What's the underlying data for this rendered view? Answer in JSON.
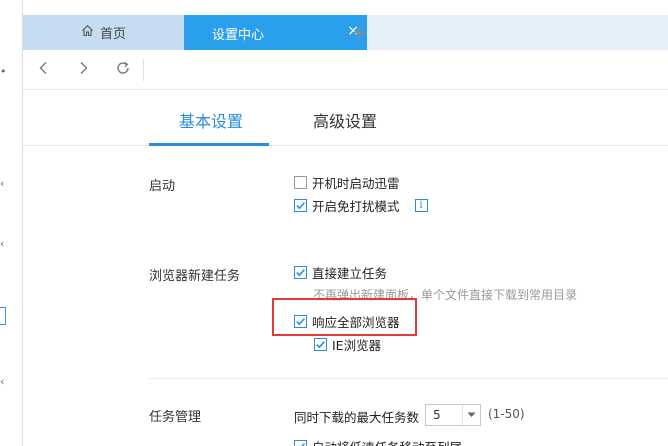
{
  "tabs": [
    {
      "label": "首页",
      "icon": "home-icon"
    },
    {
      "label": "设置中心",
      "close": "×"
    }
  ],
  "add_tab": "+",
  "settings_tabs": [
    {
      "label": "基本设置",
      "active": true
    },
    {
      "label": "高级设置",
      "active": false
    }
  ],
  "sections": {
    "startup": {
      "title": "启动",
      "options": [
        {
          "label": "开机时启动迅雷",
          "checked": false
        },
        {
          "label": "开启免打扰模式",
          "checked": true,
          "info": "i"
        }
      ]
    },
    "browser": {
      "title": "浏览器新建任务",
      "direct": {
        "label": "直接建立任务",
        "checked": true
      },
      "hint": "不再弹出新建面板，单个文件直接下载到常用目录",
      "respond_all": {
        "label": "响应全部浏览器",
        "checked": true
      },
      "ie": {
        "label": "IE浏览器",
        "checked": true
      }
    },
    "task": {
      "title": "任务管理",
      "max_label": "同时下载的最大任务数",
      "max_value": "5",
      "range": "(1-50)",
      "partial": "自动将低速任务移动至列尾"
    }
  },
  "colors": {
    "accent": "#2a8ee0",
    "tab_active": "#2aa0ec",
    "highlight": "#e03a3a"
  }
}
